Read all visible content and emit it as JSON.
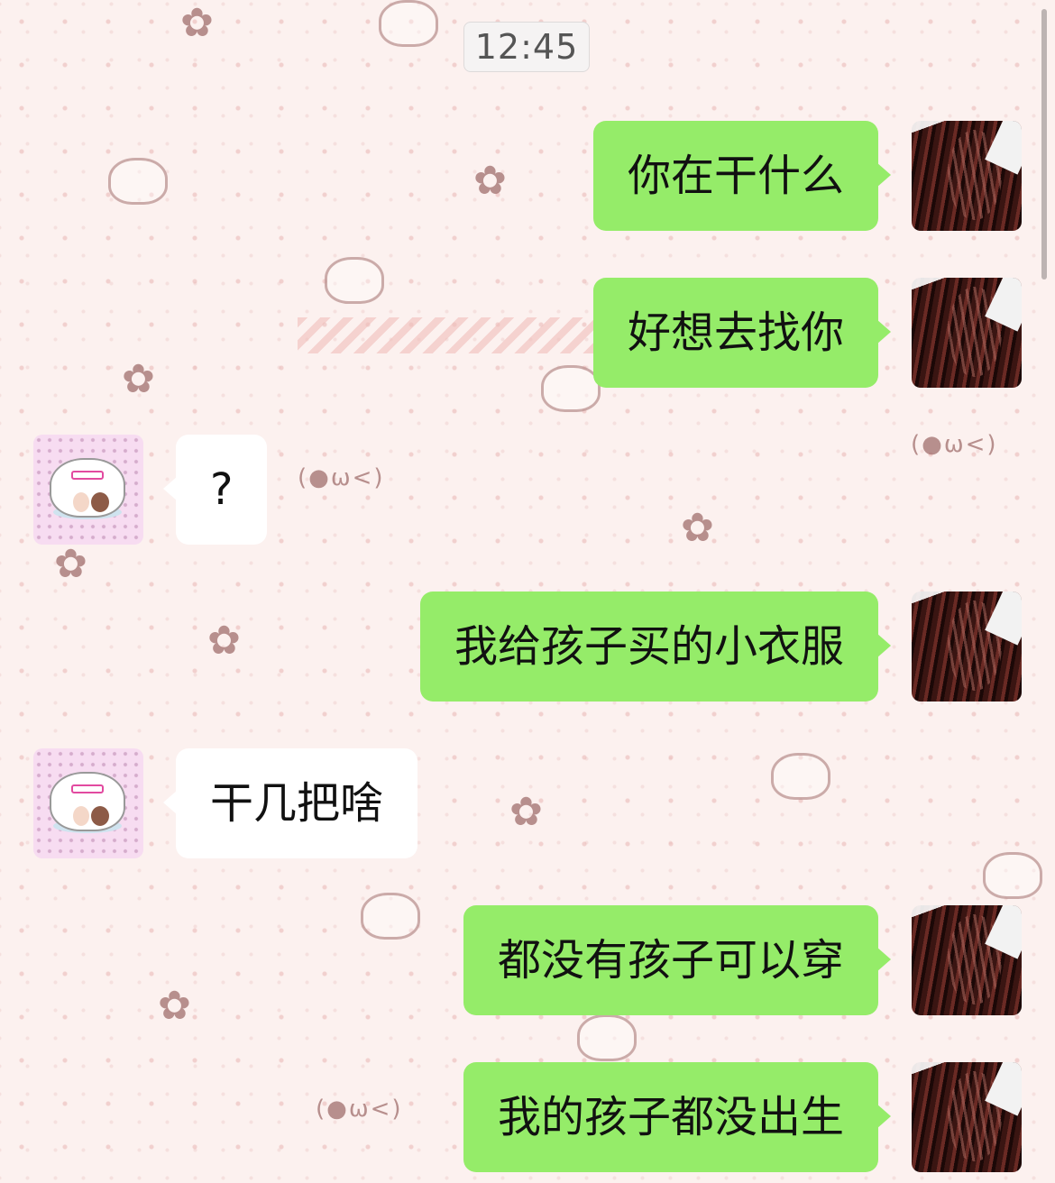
{
  "chat": {
    "timestamp": "12:45",
    "messages": [
      {
        "side": "sent",
        "text": "你在干什么"
      },
      {
        "side": "sent",
        "text": "好想去找你"
      },
      {
        "side": "received",
        "text": "?"
      },
      {
        "side": "sent",
        "text": "我给孩子买的小衣服"
      },
      {
        "side": "received",
        "text": "干几把啥"
      },
      {
        "side": "sent",
        "text": "都没有孩子可以穿"
      },
      {
        "side": "sent",
        "text": "我的孩子都没出生"
      }
    ]
  },
  "wallpaper": {
    "kaomoji": "(●ω<)",
    "flower_glyph": "✿"
  },
  "colors": {
    "sent_bubble": "#95ec69",
    "received_bubble": "#ffffff",
    "background": "#fcf1ef"
  }
}
